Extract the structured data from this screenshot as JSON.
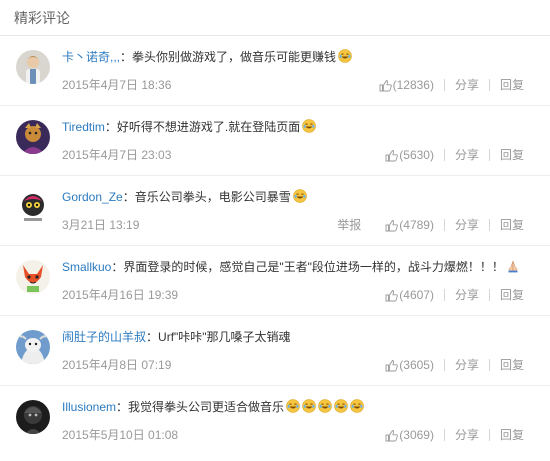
{
  "section_title": "精彩评论",
  "actions": {
    "share": "分享",
    "reply": "回复",
    "report": "举报"
  },
  "colors": {
    "username": "#2c7bc0",
    "meta": "#999999",
    "text": "#333333"
  },
  "comments": [
    {
      "user": "卡丶诺奇,,,",
      "text": "拳头你别做游戏了，做音乐可能更赚钱",
      "date": "2015年4月7日 18:36",
      "likes": "(12836)",
      "emoji_count": 1
    },
    {
      "user": "Tiredtim",
      "text": "好听得不想进游戏了.就在登陆页面",
      "date": "2015年4月7日 23:03",
      "likes": "(5630)",
      "emoji_count": 1
    },
    {
      "user": "Gordon_Ze",
      "text": "音乐公司拳头，电影公司暴雪",
      "date": "3月21日 13:19",
      "likes": "(4789)",
      "emoji_count": 1
    },
    {
      "user": "Smallkuo",
      "text": "界面登录的时候，感觉自己是\"王者\"段位进场一样的，战斗力爆燃！！！",
      "date": "2015年4月16日 19:39",
      "likes": "(4607)",
      "emoji_count": 0
    },
    {
      "user": "闹肚子的山羊叔",
      "text": "Urf\"咔咔\"那几嗓子太销魂",
      "date": "2015年4月8日 07:19",
      "likes": "(3605)",
      "emoji_count": 0
    },
    {
      "user": "Illusionem",
      "text": "我觉得拳头公司更适合做音乐",
      "date": "2015年5月10日 01:08",
      "likes": "(3069)",
      "emoji_count": 5
    }
  ]
}
